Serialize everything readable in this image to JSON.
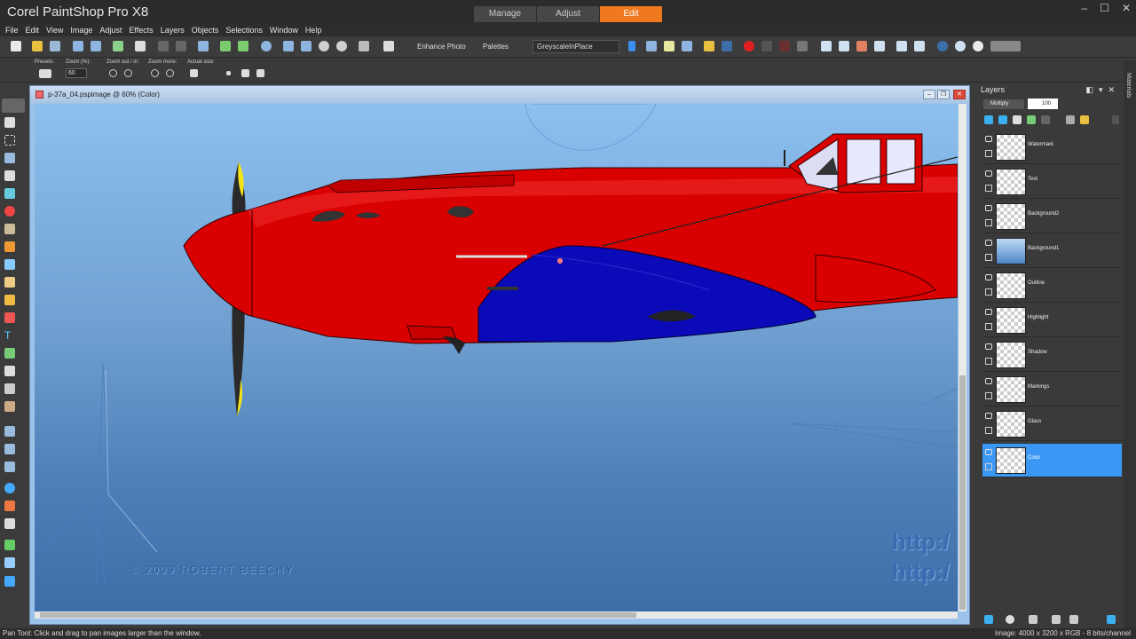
{
  "app": {
    "title": "Corel PaintShop Pro X8"
  },
  "workspace_tabs": [
    {
      "label": "Manage",
      "active": false
    },
    {
      "label": "Adjust",
      "active": false
    },
    {
      "label": "Edit",
      "active": true
    }
  ],
  "window_controls": {
    "minimize": "–",
    "maximize": "☐",
    "close": "✕"
  },
  "menu": [
    "File",
    "Edit",
    "View",
    "Image",
    "Adjust",
    "Effects",
    "Layers",
    "Objects",
    "Selections",
    "Window",
    "Help"
  ],
  "toolbar": {
    "enhance_photo": "Enhance Photo",
    "palettes": "Palettes",
    "script_select": "GreyscaleInPlace"
  },
  "tool_options": {
    "presets_label": "Presets:",
    "zoom_label": "Zoom (%):",
    "zoom_value": "60",
    "zoom_inout_label": "Zoom out / in:",
    "zoom_more_label": "Zoom more:",
    "actual_size_label": "Actual size:"
  },
  "document": {
    "title": "p-37a_04.pspimage @  60% (Color)",
    "canvas_text": {
      "copyright": "© 2009 ROBERT BEECHY",
      "url1": "http:/",
      "url2": "http:/"
    }
  },
  "layers_panel": {
    "title": "Layers",
    "blend_mode": "Multiply",
    "opacity": "100",
    "layers": [
      {
        "name": "Watermark",
        "selected": false,
        "thumb": "transparent"
      },
      {
        "name": "Text",
        "selected": false,
        "thumb": "transparent"
      },
      {
        "name": "Background2",
        "selected": false,
        "thumb": "transparent"
      },
      {
        "name": "Background1",
        "selected": false,
        "thumb": "sky"
      },
      {
        "name": "Outline",
        "selected": false,
        "thumb": "transparent"
      },
      {
        "name": "Highlight",
        "selected": false,
        "thumb": "transparent"
      },
      {
        "name": "Shadow",
        "selected": false,
        "thumb": "transparent"
      },
      {
        "name": "Markings",
        "selected": false,
        "thumb": "transparent"
      },
      {
        "name": "Glass",
        "selected": false,
        "thumb": "transparent"
      },
      {
        "name": "Color",
        "selected": true,
        "thumb": "transparent"
      }
    ]
  },
  "materials_label": "Materials",
  "status": {
    "left": "Pan Tool: Click and drag to pan images larger than the window.",
    "right": "Image:  4000 x 3200 x RGB - 8 bits/channel"
  },
  "colors": {
    "accent": "#f0781e",
    "selection": "#3b97f4",
    "plane_red": "#d80000",
    "plane_blue": "#0a0ab8"
  }
}
